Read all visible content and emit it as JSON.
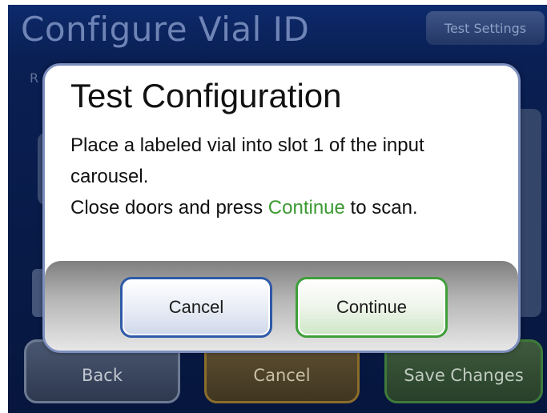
{
  "screen": {
    "title": "Configure Vial ID",
    "test_settings_label": "Test Settings",
    "background_label": "R"
  },
  "footer": {
    "back_label": "Back",
    "cancel_label": "Cancel",
    "save_label": "Save Changes"
  },
  "dialog": {
    "title": "Test Configuration",
    "line1": "Place a labeled vial into slot 1 of the input carousel.",
    "line2_prefix": "Close doors and press ",
    "line2_highlight": "Continue",
    "line2_suffix": " to scan.",
    "cancel_label": "Cancel",
    "continue_label": "Continue"
  },
  "colors": {
    "screen_background": "#0a1f53",
    "dialog_border": "#7d8fbf",
    "continue_highlight": "#3c9a32",
    "cancel_button_border": "#2e5aa8",
    "continue_button_border": "#3f9e3a"
  }
}
